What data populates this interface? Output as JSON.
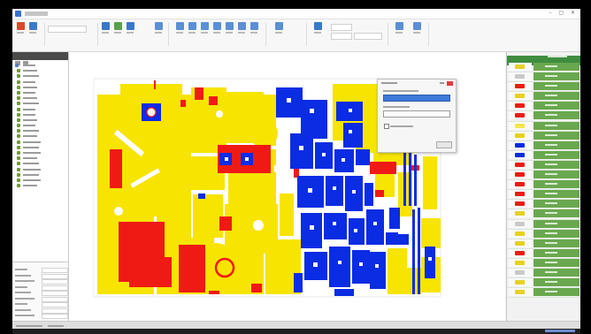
{
  "window": {
    "title": "",
    "controls": "– ▢ ✕"
  },
  "ribbon": {
    "buttons": [
      {
        "name": "new-icon",
        "color": "#d84a2f"
      },
      {
        "name": "open-icon",
        "color": "#3a78c9"
      },
      {
        "name": "import-icon",
        "color": "#3a78c9"
      },
      {
        "name": "export-icon",
        "color": "#5aa14c"
      },
      {
        "name": "arrange-icon",
        "color": "#3a78c9"
      },
      {
        "name": "select-icon",
        "color": "#5c8fd4"
      },
      {
        "name": "move-icon",
        "color": "#5c8fd4"
      },
      {
        "name": "zoom-in-icon",
        "color": "#5c8fd4"
      },
      {
        "name": "zoom-out-icon",
        "color": "#5c8fd4"
      },
      {
        "name": "zoom-fit-icon",
        "color": "#5c8fd4"
      },
      {
        "name": "rotate-icon",
        "color": "#5c8fd4"
      },
      {
        "name": "mirror-icon",
        "color": "#5c8fd4"
      },
      {
        "name": "distance-icon",
        "color": "#5c8fd4"
      },
      {
        "name": "align-icon",
        "color": "#5c8fd4"
      },
      {
        "name": "layer-icon",
        "color": "#3a78c9"
      },
      {
        "name": "settings-icon",
        "color": "#5c8fd4"
      },
      {
        "name": "help-icon",
        "color": "#5c8fd4"
      }
    ]
  },
  "colors": {
    "yellow_part": "#f7e400",
    "blue_part": "#0a2ce3",
    "red_part": "#ef1a14",
    "panel_green": "#6aa84f",
    "panel_header": "#3f8d3f",
    "dialog_close": "#e23b3b",
    "dialog_selection": "#3d79d8"
  },
  "parts_list": {
    "swatches": [
      "#e6d21e",
      "#c9c9c9",
      "#ef1a14",
      "#e6d21e",
      "#ef1a14",
      "#ef1a14",
      "#f2e84a",
      "#e6d21e",
      "#0a2ce3",
      "#0a2ce3",
      "#ef1a14",
      "#ef1a14",
      "#ef1a14",
      "#ef1a14",
      "#ef1a14",
      "#e6d21e",
      "#c9c9c9",
      "#e6d21e",
      "#e6d21e",
      "#ef1a14",
      "#e6d21e",
      "#c9c9c9",
      "#e6d21e",
      "#e6d21e"
    ]
  }
}
